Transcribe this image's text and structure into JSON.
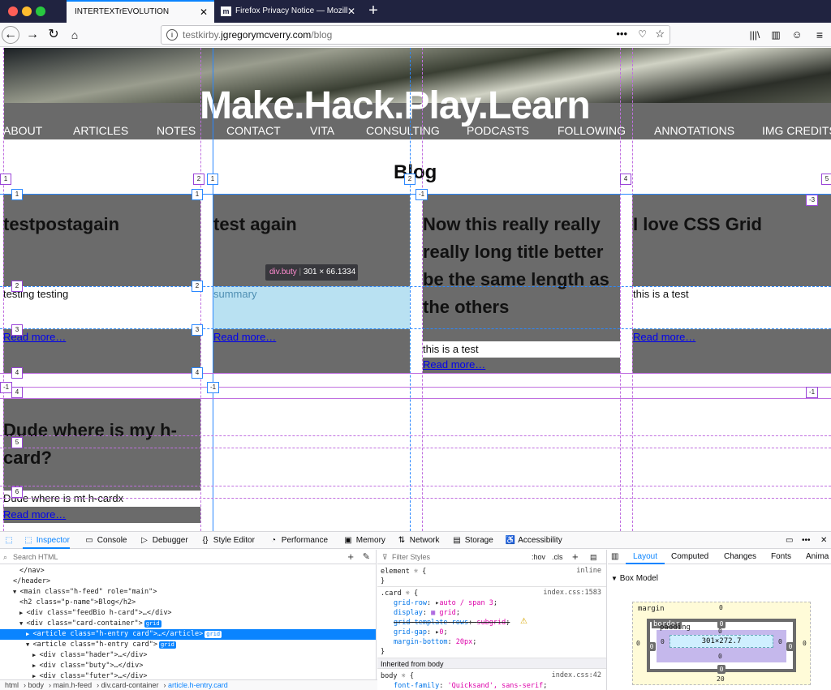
{
  "browser": {
    "tabs": [
      {
        "label": "INTERTEXTrEVOLUTION"
      },
      {
        "label": "Firefox Privacy Notice — Mozill"
      }
    ],
    "url_prefix": "testkirby.",
    "url_domain": "jgregorymcverry.com",
    "url_path": "/blog"
  },
  "site": {
    "title": "Make.Hack.Play.Learn",
    "nav": [
      "ABOUT",
      "ARTICLES",
      "NOTES",
      "CONTACT",
      "VITA",
      "CONSULTING",
      "PODCASTS",
      "FOLLOWING",
      "ANNOTATIONS",
      "IMG CREDITS"
    ],
    "heading": "Blog",
    "cards": [
      {
        "title": "testpostagain",
        "summary": "testing testing",
        "link": "Read more…"
      },
      {
        "title": "test again",
        "summary": "summary",
        "link": "Read more…"
      },
      {
        "title": "Now this really really really long title better be the same length as the others",
        "summary": "this is a test",
        "link": "Read more…"
      },
      {
        "title": "I love CSS Grid",
        "summary": "this is a test",
        "link": "Read more…"
      },
      {
        "title": "Dude where is my h-card?",
        "summary": "Dude where is mt h-cardx",
        "link": "Read more…"
      }
    ]
  },
  "overlay": {
    "tooltip_name": "div.buty",
    "tooltip_size": "301 × 66.1334",
    "col_badges": [
      "1",
      "2",
      "1",
      "2",
      "3",
      "4",
      "5"
    ],
    "row_badges": [
      "1",
      "2",
      "3",
      "4",
      "5",
      "6",
      "-1",
      "-1",
      "-3"
    ]
  },
  "devtools": {
    "tabs": [
      "Inspector",
      "Console",
      "Debugger",
      "Style Editor",
      "Performance",
      "Memory",
      "Network",
      "Storage",
      "Accessibility"
    ],
    "search_placeholder": "Search HTML",
    "markup": [
      {
        "indent": 3,
        "html": "</nav>"
      },
      {
        "indent": 2,
        "html": "</header>"
      },
      {
        "indent": 2,
        "html": "<main class=\"h-feed\" role=\"main\">"
      },
      {
        "indent": 3,
        "html": "<h2 class=\"p-name\">Blog</h2>"
      },
      {
        "indent": 3,
        "html": "<div class=\"feedBio h-card\">…</div>"
      },
      {
        "indent": 3,
        "html": "<div class=\"card-container\">",
        "badge": "grid"
      },
      {
        "indent": 4,
        "html": "<article class=\"h-entry card\">…</article>",
        "badge": "grid",
        "selected": true
      },
      {
        "indent": 4,
        "html": "<article class=\"h-entry card\">",
        "badge": "grid"
      },
      {
        "indent": 5,
        "html": "<div class=\"hader\">…</div>"
      },
      {
        "indent": 5,
        "html": "<div class=\"buty\">…</div>"
      },
      {
        "indent": 5,
        "html": "<div class=\"futer\">…</div>"
      }
    ],
    "filter_placeholder": "Filter Styles",
    "filter_buttons": [
      ":hov",
      ".cls",
      "+"
    ],
    "rules": {
      "element_label": "element",
      "element_source": "inline",
      "card_selector": ".card",
      "card_source": "index.css:1583",
      "props": [
        {
          "name": "grid-row",
          "value": "auto / span 3"
        },
        {
          "name": "display",
          "value": "grid"
        },
        {
          "name": "grid-template-rows",
          "value": "subgrid",
          "invalid": true
        },
        {
          "name": "grid-gap",
          "value": "0"
        },
        {
          "name": "margin-bottom",
          "value": "20px"
        }
      ],
      "inherited": "Inherited from body",
      "body_selector": "body",
      "body_source": "index.css:42",
      "body_prop": "font-family",
      "body_value": "'Quicksand', sans-serif"
    },
    "layout_tabs": [
      "Layout",
      "Computed",
      "Changes",
      "Fonts",
      "Anima"
    ],
    "box_model_title": "Box Model",
    "box_model": {
      "margin_label": "margin",
      "border_label": "border",
      "padding_label": "padding",
      "margin_top": "0",
      "margin_bottom": "20",
      "margin_left": "0",
      "margin_right": "0",
      "border_top": "0",
      "border_bottom": "0",
      "border_left": "0",
      "border_right": "0",
      "padding_top": "0",
      "padding_bottom": "0",
      "padding_left": "0",
      "padding_right": "0",
      "content": "301×272.7"
    },
    "breadcrumbs": [
      "html",
      "body",
      "main.h-feed",
      "div.card-container",
      "article.h-entry.card"
    ]
  }
}
